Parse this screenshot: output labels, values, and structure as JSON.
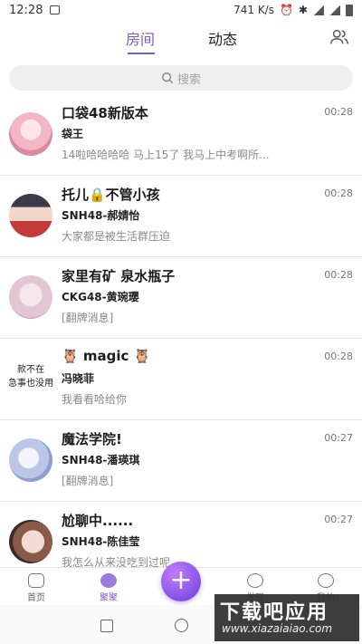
{
  "status_bar": {
    "time": "12:28",
    "network_speed": "741 K/s"
  },
  "top_nav": {
    "tabs": [
      {
        "label": "房间",
        "active": true
      },
      {
        "label": "动态",
        "active": false
      }
    ],
    "accent_color": "#7c5cc4",
    "right_icon": "contacts-icon"
  },
  "search": {
    "placeholder": "搜索",
    "icon": "search-icon"
  },
  "conversations": [
    {
      "name": "口袋48新版本",
      "sender": "袋王",
      "message": "14啦哈哈哈哈 马上15了 我马上中考啊所...",
      "time": "00:28"
    },
    {
      "name": "托儿🔒不管小孩",
      "sender": "SNH48-郝婧怡",
      "message": "大家都是被生活群压迫",
      "time": "00:28"
    },
    {
      "name": "家里有矿 泉水瓶子",
      "sender": "CKG48-黄琬璎",
      "message": "[翻牌消息]",
      "time": "00:28"
    },
    {
      "name": "🦉 magic 🦉",
      "sender": "冯晓菲",
      "message": "我看看哈给你",
      "time": "00:28",
      "avatar_text": "款不在\n急事也没用"
    },
    {
      "name": "魔法学院!",
      "sender": "SNH48-潘瑛琪",
      "message": "[翻牌消息]",
      "time": "00:27"
    },
    {
      "name": "尬聊中......",
      "sender": "SNH48-陈佳莹",
      "message": "我怎么从来没吃到过呢",
      "time": "00:27"
    }
  ],
  "bottom_nav": {
    "items": [
      {
        "label": "首页",
        "icon": "home-icon"
      },
      {
        "label": "聚聚",
        "icon": "chat-bubble-icon",
        "active": true
      },
      {
        "label": "发现",
        "icon": "discover-icon"
      },
      {
        "label": "我的",
        "icon": "profile-icon"
      }
    ],
    "fab_symbol": "+"
  },
  "watermark": {
    "title": "下载吧应用",
    "url": "www.xiazaiaiao.com"
  }
}
